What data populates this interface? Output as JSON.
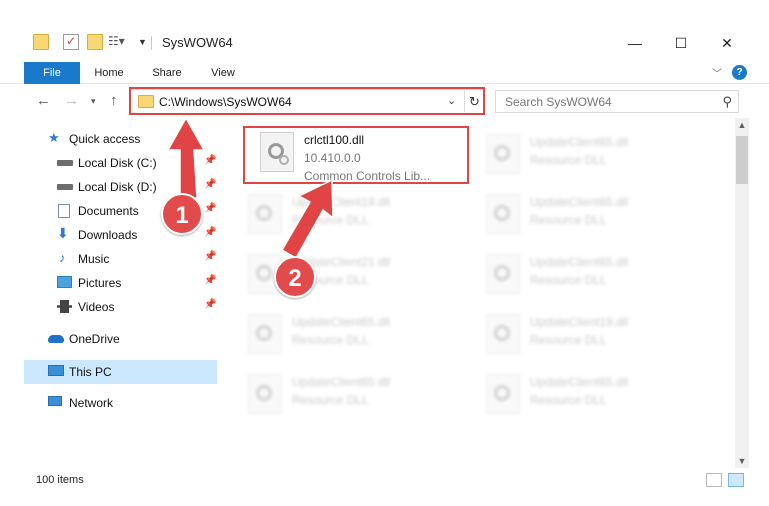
{
  "window": {
    "title": "SysWOW64",
    "controls": [
      "—",
      "☐",
      "✕"
    ]
  },
  "ribbon": {
    "tabs": [
      "File",
      "Home",
      "Share",
      "View"
    ],
    "help": "?"
  },
  "address": {
    "path": "C:\\Windows\\SysWOW64",
    "search_placeholder": "Search SysWOW64"
  },
  "sidebar": {
    "items": [
      {
        "label": "Quick access",
        "icon": "star-icon",
        "color": "#2e7bcf",
        "pinned": false
      },
      {
        "label": "Local Disk (C:)",
        "icon": "drive-icon",
        "color": "#6d6d6d",
        "pinned": true
      },
      {
        "label": "Local Disk (D:)",
        "icon": "drive-icon",
        "color": "#6d6d6d",
        "pinned": true
      },
      {
        "label": "Documents",
        "icon": "documents-icon",
        "color": "#7a8ea8",
        "pinned": true
      },
      {
        "label": "Downloads",
        "icon": "download-icon",
        "color": "#2e7bcf",
        "pinned": true
      },
      {
        "label": "Music",
        "icon": "music-icon",
        "color": "#2e7bcf",
        "pinned": true
      },
      {
        "label": "Pictures",
        "icon": "pictures-icon",
        "color": "#4aa3df",
        "pinned": true
      },
      {
        "label": "Videos",
        "icon": "video-icon",
        "color": "#444444",
        "pinned": true
      },
      {
        "label": "OneDrive",
        "icon": "cloud-icon",
        "color": "#1e73c8",
        "pinned": false
      },
      {
        "label": "This PC",
        "icon": "computer-icon",
        "color": "#3b8fd6",
        "pinned": false,
        "selected": true
      },
      {
        "label": "Network",
        "icon": "network-icon",
        "color": "#3b8fd6",
        "pinned": false
      }
    ]
  },
  "files": {
    "highlighted": {
      "name": "crlctl100.dll",
      "version": "10.410.0.0",
      "description": "Common Controls Lib..."
    },
    "left_column": [
      {
        "name": "UpdateClient19.dll",
        "type": "Resource DLL"
      },
      {
        "name": "UpdateClient21.dll",
        "type": "Resource DLL"
      },
      {
        "name": "UpdateClient65.dll",
        "type": "Resource DLL"
      },
      {
        "name": "UpdateClient65.dll",
        "type": "Resource DLL"
      }
    ],
    "right_column": [
      {
        "name": "UpdateClient65.dll",
        "type": "Resource DLL"
      },
      {
        "name": "UpdateClient65.dll",
        "type": "Resource DLL"
      },
      {
        "name": "UpdateClient65.dll",
        "type": "Resource DLL"
      },
      {
        "name": "UpdateClient19.dll",
        "type": "Resource DLL"
      },
      {
        "name": "UpdateClient65.dll",
        "type": "Resource DLL"
      }
    ]
  },
  "status": {
    "count": "100 items"
  },
  "annotations": {
    "step1": "1",
    "step2": "2",
    "color": "#e04444"
  }
}
